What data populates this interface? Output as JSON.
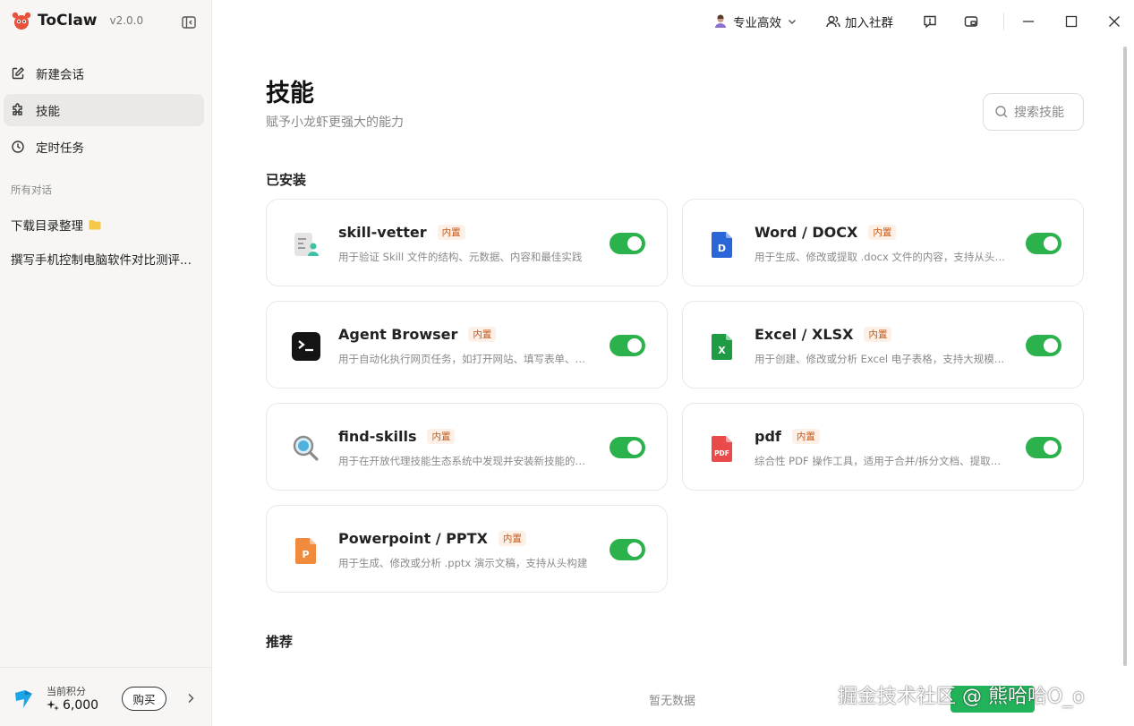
{
  "app": {
    "name": "ToClaw",
    "version": "v2.0.0"
  },
  "sidebar": {
    "nav": [
      {
        "label": "新建会话",
        "icon": "edit-icon"
      },
      {
        "label": "技能",
        "icon": "puzzle-icon"
      },
      {
        "label": "定时任务",
        "icon": "clock-icon"
      }
    ],
    "section_label": "所有对话",
    "conversations": [
      {
        "title": "下载目录整理",
        "icon": "folder-icon"
      },
      {
        "title": "撰写手机控制电脑软件对比测评..."
      }
    ],
    "footer": {
      "points_label": "当前积分",
      "points_value": "6,000",
      "buy_label": "购买"
    }
  },
  "topbar": {
    "mode_label": "专业高效",
    "community_label": "加入社群"
  },
  "main": {
    "title": "技能",
    "subtitle": "赋予小龙虾更强大的能力",
    "search_placeholder": "搜索技能",
    "installed_heading": "已安装",
    "recommended_heading": "推荐",
    "empty_text": "暂无数据",
    "badge_label": "内置",
    "skills": [
      {
        "name": "skill-vetter",
        "desc": "用于验证 Skill 文件的结构、元数据、内容和最佳实践",
        "icon": "skill-vetter-icon",
        "enabled": true
      },
      {
        "name": "Word / DOCX",
        "desc": "用于生成、修改或提取 .docx 文件的内容，支持从头构建",
        "icon": "word-doc-icon",
        "enabled": true
      },
      {
        "name": "Agent Browser",
        "desc": "用于自动化执行网页任务，如打开网站、填写表单、截图",
        "icon": "terminal-icon",
        "enabled": true
      },
      {
        "name": "Excel / XLSX",
        "desc": "用于创建、修改或分析 Excel 电子表格，支持大规模数据处理",
        "icon": "excel-icon",
        "enabled": true
      },
      {
        "name": "find-skills",
        "desc": "用于在开放代理技能生态系统中发现并安装新技能的工具",
        "icon": "magnifier-icon",
        "enabled": true
      },
      {
        "name": "pdf",
        "desc": "综合性 PDF 操作工具，适用于合并/拆分文档、提取文本",
        "icon": "pdf-icon",
        "enabled": true
      },
      {
        "name": "Powerpoint / PPTX",
        "desc": "用于生成、修改或分析 .pptx 演示文稿，支持从头构建",
        "icon": "powerpoint-icon",
        "enabled": true
      }
    ]
  },
  "watermark": "掘金技术社区 @ 熊哈哈O_o",
  "colors": {
    "toggle_on": "#2bb24c",
    "badge_text": "#c4581a",
    "badge_bg": "#fdf0e6",
    "sidebar_bg": "#f7f6f4"
  }
}
